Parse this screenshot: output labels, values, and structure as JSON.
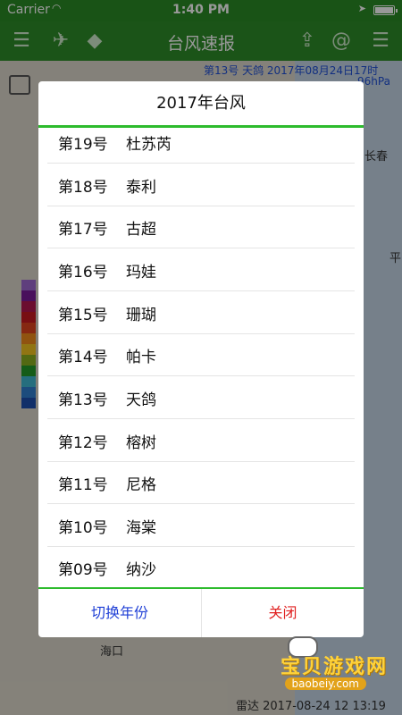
{
  "status_bar": {
    "carrier": "Carrier",
    "time": "1:40 PM"
  },
  "nav": {
    "title": "台风速报"
  },
  "map": {
    "info_line": "第13号  天鸽  2017年08月24日17时",
    "info_line2": "96hPa",
    "cities": [
      "长春",
      "海口",
      "平"
    ],
    "bottom_text": "雷达 2017-08-24 12 13:19"
  },
  "dialog": {
    "title": "2017年台风",
    "typhoons": [
      {
        "number": "第19号",
        "name": "杜苏芮"
      },
      {
        "number": "第18号",
        "name": "泰利"
      },
      {
        "number": "第17号",
        "name": "古超"
      },
      {
        "number": "第16号",
        "name": "玛娃"
      },
      {
        "number": "第15号",
        "name": "珊瑚"
      },
      {
        "number": "第14号",
        "name": "帕卡"
      },
      {
        "number": "第13号",
        "name": "天鸽"
      },
      {
        "number": "第12号",
        "name": "榕树"
      },
      {
        "number": "第11号",
        "name": "尼格"
      },
      {
        "number": "第10号",
        "name": "海棠"
      },
      {
        "number": "第09号",
        "name": "纳沙"
      }
    ],
    "switch_label": "切换年份",
    "close_label": "关闭"
  },
  "watermark": {
    "title": "宝贝游戏网",
    "site": "baobeiy.com"
  },
  "colors": {
    "nav_green": "#2e8c28",
    "divider_green": "#2dbb2d",
    "link_blue": "#1f3fd6",
    "close_red": "#e02020"
  }
}
